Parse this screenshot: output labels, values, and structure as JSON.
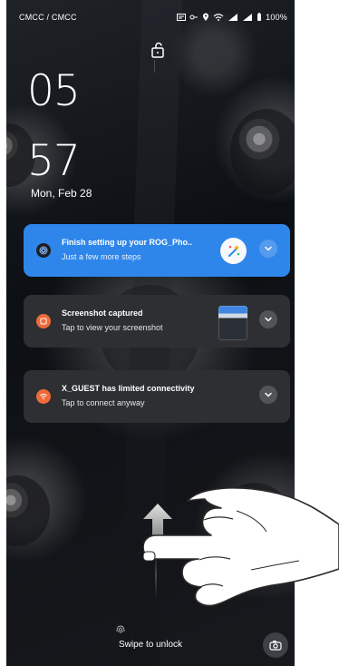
{
  "status_bar": {
    "carrier": "CMCC / CMCC",
    "battery": "100%",
    "icons": [
      "screen-record-icon",
      "key-icon",
      "location-icon",
      "wifi-icon",
      "signal-icon",
      "signal-icon",
      "battery-icon"
    ]
  },
  "lock_screen": {
    "hour": "05",
    "minute": "57",
    "date": "Mon, Feb 28",
    "swipe_text": "Swipe to unlock"
  },
  "notifications": [
    {
      "title": "Finish setting up your ROG_Pho..",
      "subtitle": "Just a few more steps",
      "icon": "settings-icon",
      "accent": "#2f86ea"
    },
    {
      "title": "Screenshot captured",
      "subtitle": "Tap to view your screenshot",
      "icon": "screenshot-icon",
      "accent": "#ef6a3b"
    },
    {
      "title": "X_GUEST has limited connectivity",
      "subtitle": "Tap to connect anyway",
      "icon": "wifi-warning-icon",
      "accent": "#ef6a3b"
    }
  ],
  "colors": {
    "screen_background": "#121518",
    "primary_notification": "#2f86ea",
    "secondary_notification": "#2d2f32",
    "text": "#ffffff"
  }
}
